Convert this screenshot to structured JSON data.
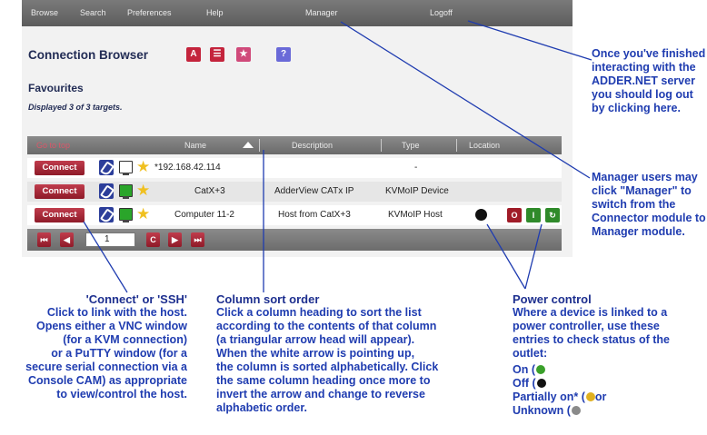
{
  "menu": {
    "browse": "Browse",
    "search": "Search",
    "preferences": "Preferences",
    "help": "Help",
    "manager": "Manager",
    "logoff": "Logoff"
  },
  "page": {
    "title": "Connection Browser",
    "icons": [
      {
        "label": "A",
        "name": "alpha-view-icon",
        "color": "#c4243c"
      },
      {
        "label": "☰",
        "name": "list-view-icon",
        "color": "#c4243c"
      },
      {
        "label": "★",
        "name": "favourites-icon",
        "color": "#d04a7a"
      },
      {
        "label": "?",
        "name": "help-icon",
        "color": "#6a6ad8"
      }
    ],
    "section": "Favourites",
    "displayed": "Displayed 3 of 3 targets."
  },
  "table": {
    "columns": [
      "Go to top",
      "Name",
      "Description",
      "Type",
      "Location"
    ],
    "connect_label": "Connect",
    "rows": [
      {
        "name": "*192.168.42.114",
        "description": "",
        "type": "-"
      },
      {
        "name": "CatX+3",
        "description": "AdderView CATx IP",
        "type": "KVMoIP Device"
      },
      {
        "name": "Computer 11-2",
        "description": "Host from CatX+3",
        "type": "KVMoIP Host"
      }
    ],
    "power": {
      "off": "O",
      "on": "I",
      "cycle": "↻"
    }
  },
  "pager": {
    "first": "⏮",
    "prev": "◀",
    "page": "1",
    "refresh": "C",
    "next": "▶",
    "last": "⏭"
  },
  "callouts": {
    "logoff": "Once you've finished interacting with the ADDER.NET server you should log out by clicking here.",
    "manager": "Manager users may click \"Manager\" to switch from the Connector module to Manager module.",
    "connect_title": "'Connect' or 'SSH'",
    "connect_body": [
      "Click to link with the host.",
      "Opens either a VNC window",
      "(for a KVM connection)",
      "or a PuTTY window (for a",
      "secure serial connection via a",
      "Console CAM) as appropriate",
      "to view/control the host."
    ],
    "sort_title": "Column sort order",
    "sort_body": [
      "Click a column heading to sort the list",
      "according to the contents of that column",
      "(a triangular arrow head will appear).",
      "When the white arrow is pointing up,",
      "the column is sorted alphabetically. Click",
      "the same column heading once more to",
      "invert the arrow and change to reverse",
      "alphabetic order."
    ],
    "power_title": "Power control",
    "power_body": [
      "Where a device is linked to a",
      "power controller, use these",
      "entries to check status of the",
      "outlet:"
    ],
    "power_on": "On (",
    "power_off": "Off (",
    "power_partial": "Partially on* (",
    "power_partial_tail": "or",
    "power_unknown": "Unknown ("
  },
  "colors": {
    "on": "#3aa02a",
    "off": "#111111",
    "partial": "#e0b020",
    "unknown": "#8a8a8a"
  }
}
